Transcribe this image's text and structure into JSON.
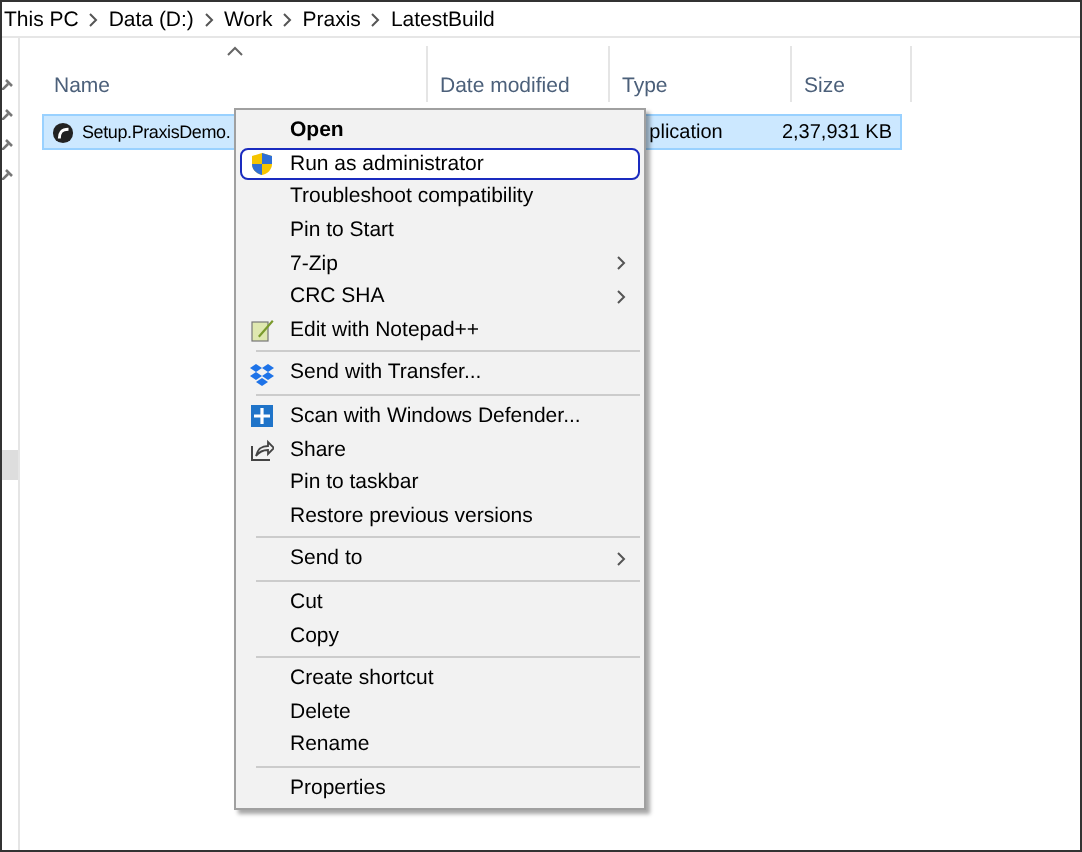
{
  "breadcrumb": [
    "This PC",
    "Data (D:)",
    "Work",
    "Praxis",
    "LatestBuild"
  ],
  "columns": [
    {
      "label": "Name",
      "sorted": true
    },
    {
      "label": "Date modified",
      "sorted": false
    },
    {
      "label": "Type",
      "sorted": false
    },
    {
      "label": "Size",
      "sorted": false
    }
  ],
  "files": [
    {
      "name": "Setup.PraxisDemo.",
      "type": "plication",
      "size": "2,37,931 KB",
      "selected": true
    }
  ],
  "context_menu": [
    {
      "kind": "plain",
      "label": "Open",
      "default": true,
      "selected": false,
      "submenu": false
    },
    {
      "kind": "shield",
      "label": "Run as administrator",
      "default": false,
      "selected": true,
      "submenu": false
    },
    {
      "kind": "plain",
      "label": "Troubleshoot compatibility",
      "default": false,
      "selected": false,
      "submenu": false
    },
    {
      "kind": "plain",
      "label": "Pin to Start",
      "default": false,
      "selected": false,
      "submenu": false
    },
    {
      "kind": "plain",
      "label": "7-Zip",
      "default": false,
      "selected": false,
      "submenu": true
    },
    {
      "kind": "plain",
      "label": "CRC SHA",
      "default": false,
      "selected": false,
      "submenu": true
    },
    {
      "kind": "notepad",
      "label": "Edit with Notepad++",
      "default": false,
      "selected": false,
      "submenu": false
    },
    {
      "kind": "separator"
    },
    {
      "kind": "dropbox",
      "label": "Send with Transfer...",
      "default": false,
      "selected": false,
      "submenu": false
    },
    {
      "kind": "separator"
    },
    {
      "kind": "defender",
      "label": "Scan with Windows Defender...",
      "default": false,
      "selected": false,
      "submenu": false
    },
    {
      "kind": "share",
      "label": "Share",
      "default": false,
      "selected": false,
      "submenu": false
    },
    {
      "kind": "plain",
      "label": "Pin to taskbar",
      "default": false,
      "selected": false,
      "submenu": false
    },
    {
      "kind": "plain",
      "label": "Restore previous versions",
      "default": false,
      "selected": false,
      "submenu": false
    },
    {
      "kind": "separator"
    },
    {
      "kind": "plain",
      "label": "Send to",
      "default": false,
      "selected": false,
      "submenu": true
    },
    {
      "kind": "separator"
    },
    {
      "kind": "plain",
      "label": "Cut",
      "default": false,
      "selected": false,
      "submenu": false
    },
    {
      "kind": "plain",
      "label": "Copy",
      "default": false,
      "selected": false,
      "submenu": false
    },
    {
      "kind": "separator"
    },
    {
      "kind": "plain",
      "label": "Create shortcut",
      "default": false,
      "selected": false,
      "submenu": false
    },
    {
      "kind": "plain",
      "label": "Delete",
      "default": false,
      "selected": false,
      "submenu": false
    },
    {
      "kind": "plain",
      "label": "Rename",
      "default": false,
      "selected": false,
      "submenu": false
    },
    {
      "kind": "separator"
    },
    {
      "kind": "plain",
      "label": "Properties",
      "default": false,
      "selected": false,
      "submenu": false
    }
  ]
}
